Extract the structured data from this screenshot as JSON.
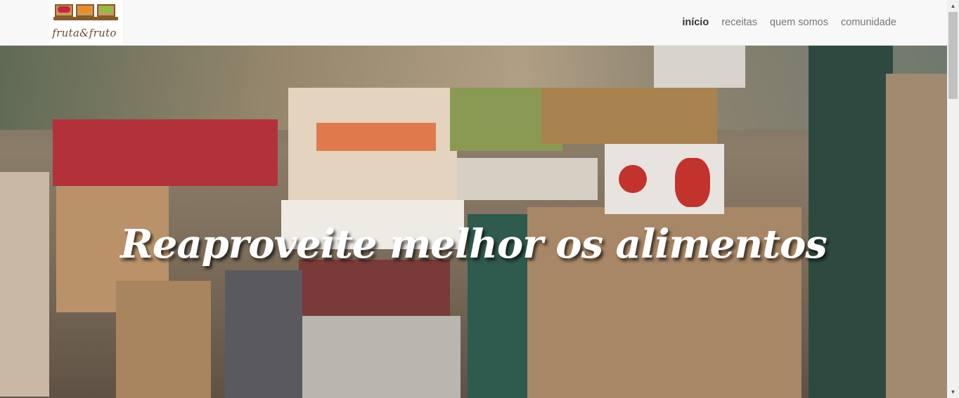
{
  "brand": {
    "name": "fruta&fruto"
  },
  "nav": {
    "items": [
      {
        "label": "início",
        "active": true
      },
      {
        "label": "receitas",
        "active": false
      },
      {
        "label": "quem somos",
        "active": false
      },
      {
        "label": "comunidade",
        "active": false
      }
    ]
  },
  "hero": {
    "title": "Reaproveite melhor os alimentos",
    "background_image": "market-crates-photo"
  },
  "colors": {
    "navbar_bg": "#f8f8f8",
    "nav_active": "#333333",
    "nav_inactive": "#777777",
    "hero_text": "#ffffff"
  },
  "icons": {
    "scroll_up": "triangle-up-icon",
    "scroll_down": "triangle-down-icon"
  }
}
